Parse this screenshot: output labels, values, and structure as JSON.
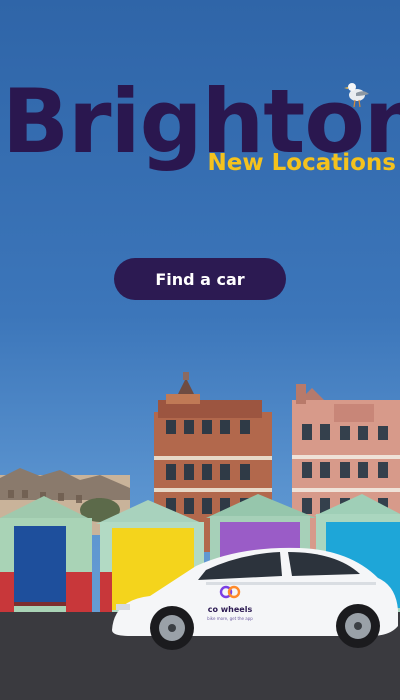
{
  "promo": {
    "title": "Brighton",
    "subtitle": "New Locations",
    "cta_label": "Find a car"
  },
  "car_branding": {
    "name": "co wheels",
    "tagline": "bike more, get the app"
  },
  "colors": {
    "sky": "#3c76ba",
    "title": "#2a174f",
    "subtitle": "#f4c21d",
    "button_bg": "#2c1a52",
    "button_text": "#ffffff"
  }
}
